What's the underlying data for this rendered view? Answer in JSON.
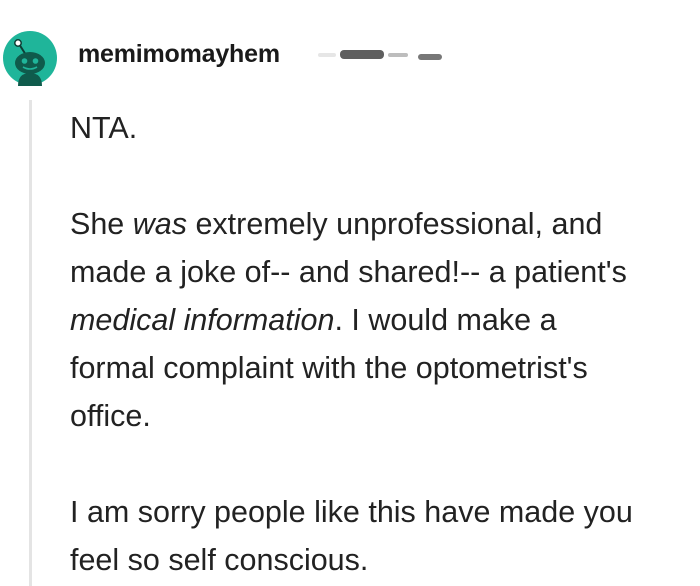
{
  "comment": {
    "author": {
      "username": "memimomayhem",
      "avatar_icon": "snoo-avatar-icon",
      "avatar_color": "#1fb59a"
    },
    "body": {
      "verdict": "NTA.",
      "p2_line1_a": "She ",
      "p2_line1_em": "was",
      "p2_line1_b": " extremely unprofessional, and",
      "p2_line2": "made a joke of-- and shared!-- a patient's",
      "p2_line3_em": "medical information",
      "p2_line3_b": ". I would make a",
      "p2_line4": "formal complaint with the optometrist's",
      "p2_line5": "office.",
      "p3_line1": "I am sorry people like this have made you",
      "p3_line2": "feel so self conscious."
    }
  }
}
